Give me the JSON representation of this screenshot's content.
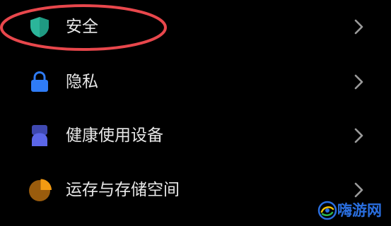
{
  "settings": {
    "items": [
      {
        "label": "安全",
        "icon": "shield-icon",
        "highlighted": true
      },
      {
        "label": "隐私",
        "icon": "lock-icon"
      },
      {
        "label": "健康使用设备",
        "icon": "hourglass-icon"
      },
      {
        "label": "运存与存储空间",
        "icon": "pie-chart-icon"
      }
    ],
    "chevron_icon": "chevron-right-icon"
  },
  "annotation": {
    "color": "#e8474c"
  },
  "watermark": {
    "text": "嗨游网",
    "text_color": "#2a6fe0"
  },
  "colors": {
    "background": "#000000",
    "label_text": "#e8e8e8",
    "shield": "#2bb59a",
    "lock": "#2f7cf6",
    "hourglass": "#5b66e8",
    "pie_primary": "#f29a12",
    "pie_secondary": "#9a5c0d",
    "chevron": "#9a9a9a"
  }
}
